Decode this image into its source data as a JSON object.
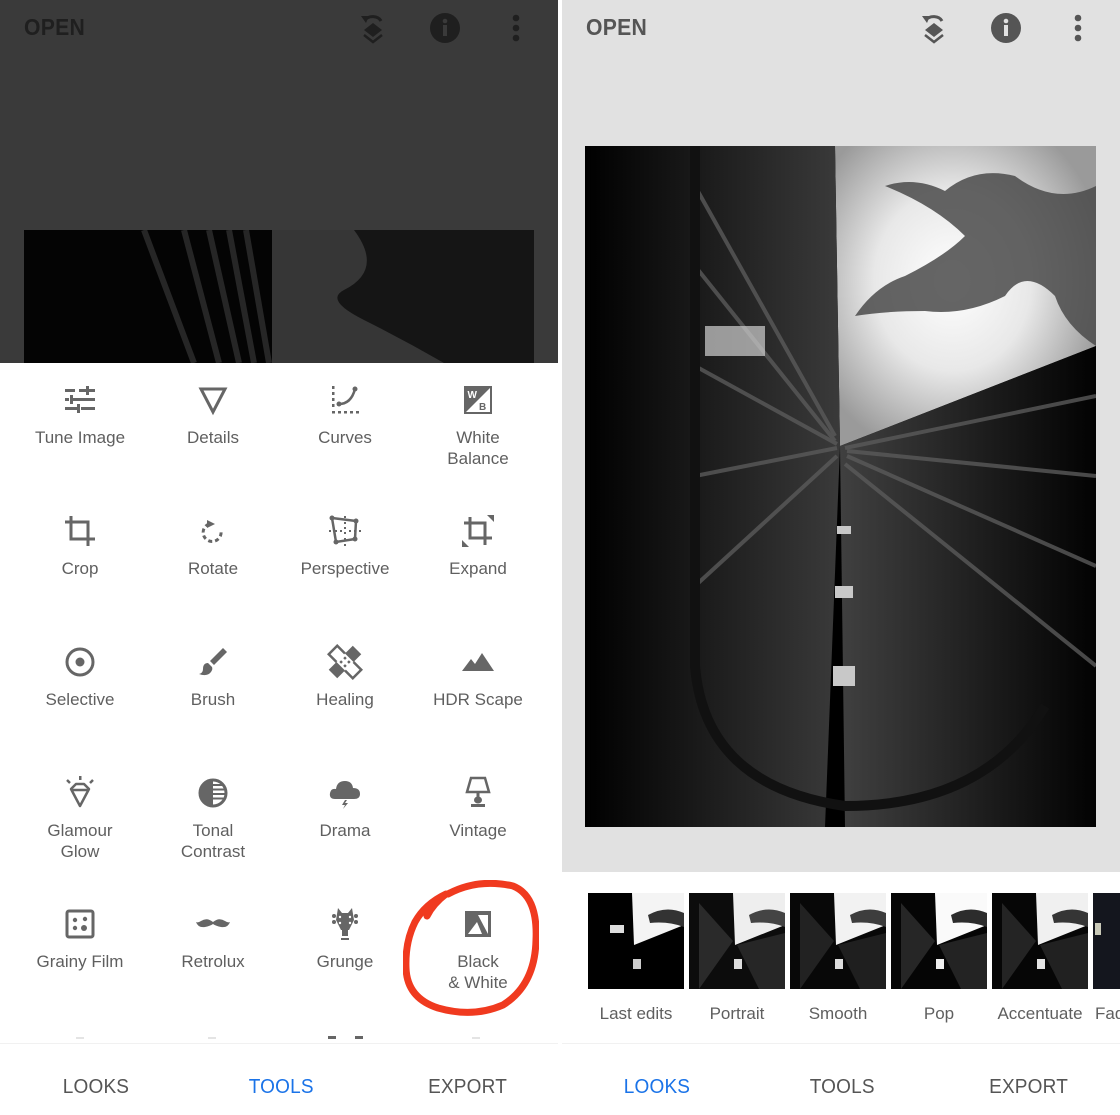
{
  "colors": {
    "accent": "#1a73e8",
    "annotation": "#f03a1f",
    "icon": "#666666",
    "label": "#5f5f5f",
    "editor_bg_dimmed": "#3a3a3a",
    "editor_bg": "#e1e1e1"
  },
  "left_screen": {
    "appbar": {
      "open_label": "OPEN",
      "icons": [
        "undo-layers-icon",
        "info-icon",
        "more-vert-icon"
      ]
    },
    "tools": [
      {
        "label": "Tune Image",
        "icon": "tune-sliders-icon"
      },
      {
        "label": "Details",
        "icon": "details-triangle-icon"
      },
      {
        "label": "Curves",
        "icon": "curves-icon"
      },
      {
        "label": "White\nBalance",
        "icon": "white-balance-icon"
      },
      {
        "label": "Crop",
        "icon": "crop-icon"
      },
      {
        "label": "Rotate",
        "icon": "rotate-icon"
      },
      {
        "label": "Perspective",
        "icon": "perspective-icon"
      },
      {
        "label": "Expand",
        "icon": "expand-icon"
      },
      {
        "label": "Selective",
        "icon": "selective-icon"
      },
      {
        "label": "Brush",
        "icon": "brush-icon"
      },
      {
        "label": "Healing",
        "icon": "healing-icon"
      },
      {
        "label": "HDR Scape",
        "icon": "mountains-icon"
      },
      {
        "label": "Glamour\nGlow",
        "icon": "diamond-icon"
      },
      {
        "label": "Tonal\nContrast",
        "icon": "tonal-contrast-icon"
      },
      {
        "label": "Drama",
        "icon": "storm-cloud-icon"
      },
      {
        "label": "Vintage",
        "icon": "lamp-icon"
      },
      {
        "label": "Grainy Film",
        "icon": "grain-icon"
      },
      {
        "label": "Retrolux",
        "icon": "mustache-icon"
      },
      {
        "label": "Grunge",
        "icon": "guitar-head-icon"
      },
      {
        "label": "Black\n& White",
        "icon": "black-white-icon",
        "highlighted": true
      }
    ],
    "bottom_nav": {
      "tabs": [
        "LOOKS",
        "TOOLS",
        "EXPORT"
      ],
      "active": "TOOLS"
    }
  },
  "right_screen": {
    "appbar": {
      "open_label": "OPEN",
      "icons": [
        "undo-layers-icon",
        "info-icon",
        "more-vert-icon"
      ]
    },
    "looks": [
      {
        "label": "Last edits"
      },
      {
        "label": "Portrait"
      },
      {
        "label": "Smooth"
      },
      {
        "label": "Pop"
      },
      {
        "label": "Accentuate"
      },
      {
        "label": "Faded Glow",
        "partially_visible": true
      }
    ],
    "bottom_nav": {
      "tabs": [
        "LOOKS",
        "TOOLS",
        "EXPORT"
      ],
      "active": "LOOKS"
    }
  }
}
